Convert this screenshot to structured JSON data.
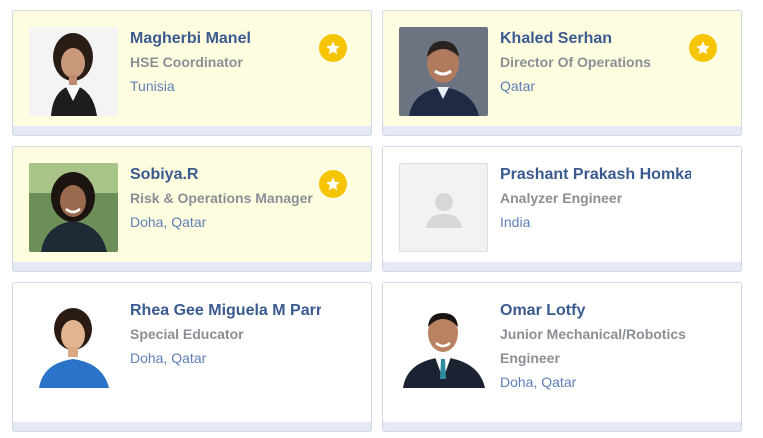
{
  "colors": {
    "name": "#3b5a8f",
    "role": "#8a8f96",
    "location": "#5d7fb8",
    "featured_bg": "#fffde0",
    "star": "#f6c400"
  },
  "cards": [
    {
      "name": "Magherbi Manel",
      "role": "HSE Coordinator",
      "location": "Tunisia",
      "featured": true,
      "icon": "star-icon"
    },
    {
      "name": "Khaled Serhan",
      "role": "Director Of Operations",
      "location": "Qatar",
      "featured": true,
      "icon": "star-icon"
    },
    {
      "name": "Sobiya.R",
      "role": "Risk & Operations Manager",
      "location": "Doha, Qatar",
      "featured": true,
      "icon": "star-icon"
    },
    {
      "name": "Prashant Prakash Homkar",
      "role": "Analyzer Engineer",
      "location": "India",
      "featured": false,
      "icon": "user-placeholder-icon"
    },
    {
      "name": "Rhea Gee Miguela M Parro",
      "role": "Special Educator",
      "location": "Doha, Qatar",
      "featured": false
    },
    {
      "name": "Omar Lotfy",
      "role": "Junior Mechanical/Robotics Engineer",
      "location": "Doha, Qatar",
      "featured": false
    }
  ]
}
